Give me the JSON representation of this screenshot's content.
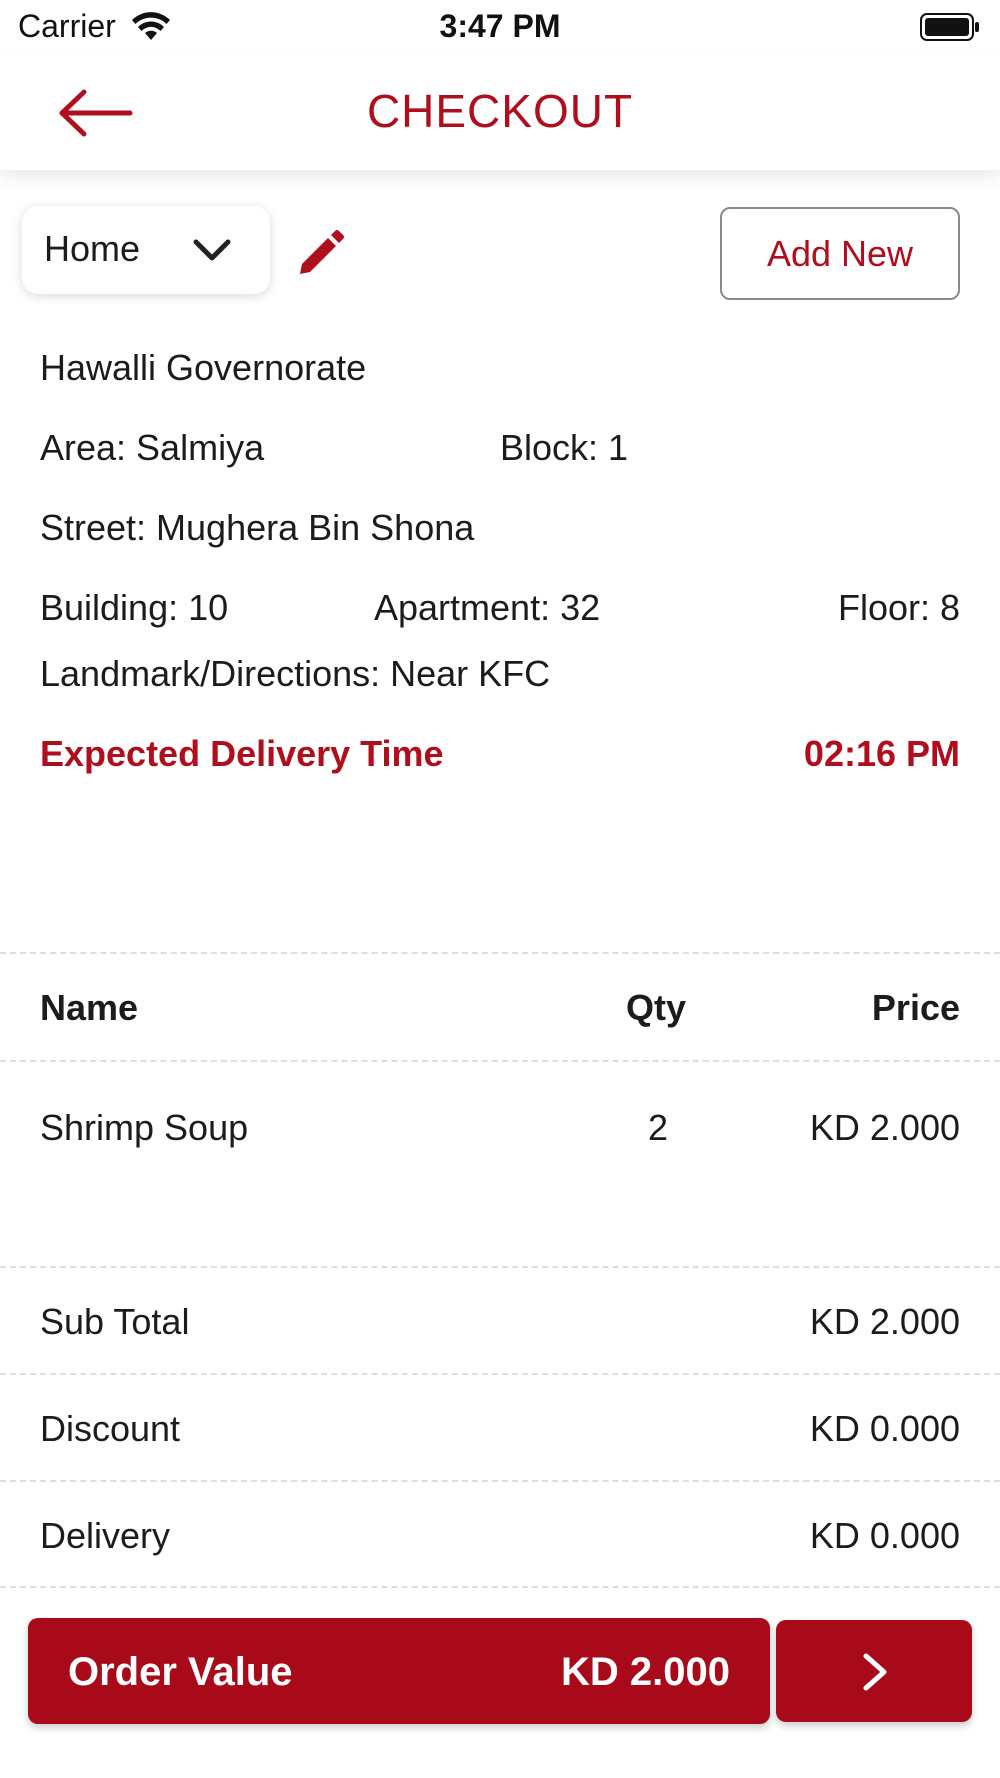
{
  "status_bar": {
    "carrier": "Carrier",
    "time": "3:47 PM",
    "icons": [
      "wifi-icon",
      "battery-icon"
    ]
  },
  "header": {
    "title": "CHECKOUT",
    "back_icon": "arrow-left-icon"
  },
  "address_controls": {
    "selected_address": "Home",
    "dropdown_icon": "chevron-down-icon",
    "edit_icon": "pencil-icon",
    "add_new_label": "Add New"
  },
  "address": {
    "governorate": "Hawalli Governorate",
    "area": "Area: Salmiya",
    "block": "Block: 1",
    "street": "Street: Mughera Bin Shona",
    "building": "Building: 10",
    "apartment": "Apartment: 32",
    "floor": "Floor: 8",
    "landmark": "Landmark/Directions: Near KFC"
  },
  "delivery": {
    "label": "Expected Delivery Time",
    "time": "02:16 PM"
  },
  "items_table": {
    "headers": {
      "name": "Name",
      "qty": "Qty",
      "price": "Price"
    },
    "rows": [
      {
        "name": "Shrimp Soup",
        "qty": "2",
        "price": "KD 2.000"
      }
    ]
  },
  "totals": {
    "subtotal_label": "Sub Total",
    "subtotal_value": "KD 2.000",
    "discount_label": "Discount",
    "discount_value": "KD 0.000",
    "delivery_label": "Delivery",
    "delivery_value": "KD 0.000"
  },
  "order_bar": {
    "label": "Order Value",
    "value": "KD 2.000",
    "next_icon": "chevron-right-icon"
  },
  "colors": {
    "accent": "#b00d1d",
    "button_bg": "#a90a1a",
    "text": "#1c1c1c",
    "divider": "#dedede"
  }
}
